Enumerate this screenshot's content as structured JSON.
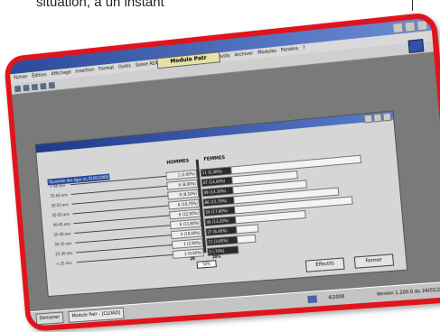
{
  "caption": "situation, à un instant",
  "window": {
    "module_title": "Module Patr",
    "menu": [
      "Fichier",
      "Édition",
      "Affichage",
      "Insertion",
      "Format",
      "Outils",
      "Saisie RDP",
      "Paramétrage",
      "Dossier",
      "Outils",
      "Archiver",
      "Modules",
      "Fenêtre",
      "?"
    ]
  },
  "dialog": {
    "subtitle": "Pyramide des âges au 01/01/2008",
    "col_hommes": "HOMMES",
    "col_femmes": "FEMMES",
    "rows": [
      {
        "age": "> 60 ans",
        "hommes": "1 (2,90%)",
        "femmes": "11 (5,30%)",
        "f_frac": 0.92
      },
      {
        "age": "55-60 ans",
        "hommes": "6 (8,90%)",
        "femmes": "47 (14,00%)",
        "f_frac": 0.55
      },
      {
        "age": "50-55 ans",
        "hommes": "6 (8,50%)",
        "femmes": "49 (14,30%)",
        "f_frac": 0.6
      },
      {
        "age": "45-50 ans",
        "hommes": "6 (10,70%)",
        "femmes": "86 (15,70%)",
        "f_frac": 0.78
      },
      {
        "age": "40-45 ans",
        "hommes": "6 (12,90%)",
        "femmes": "59 (17,60%)",
        "f_frac": 0.85
      },
      {
        "age": "35-40 ans",
        "hommes": "6 (11,80%)",
        "femmes": "46 (13,20%)",
        "f_frac": 0.58
      },
      {
        "age": "30-35 ans",
        "hommes": "4 (19,00%)",
        "femmes": "27 (6,40%)",
        "f_frac": 0.3
      },
      {
        "age": "25-30 ans",
        "hommes": "1 (2,90%)",
        "femmes": "11 (3,60%)",
        "f_frac": 0.28
      },
      {
        "age": "< 25 ans",
        "hommes": "2 (0,60%)",
        "femmes": "3 (,70%)",
        "f_frac": 0.05
      }
    ],
    "pct_left": "20",
    "pct_right": "20%",
    "mid_box": "50%",
    "btn_effectifs": "Effectifs",
    "btn_fermer": "Fermer"
  },
  "taskbar": {
    "start": "Démarrer",
    "task": "Module Patr - [CLOAD]",
    "date": "4/2008",
    "version": "Version 1.100.0 du 24/01/2008"
  },
  "colors": {
    "frame": "#e0141c",
    "title_blue": "#2b4b9a"
  }
}
